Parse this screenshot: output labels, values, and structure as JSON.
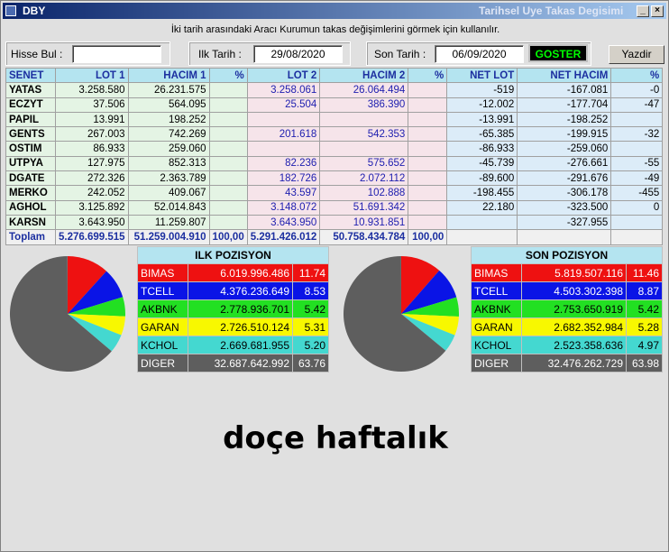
{
  "window": {
    "title": "DBY",
    "message": "Tarihsel Uye Takas Degisimi"
  },
  "info_text": "İki tarih arasındaki  Aracı Kurumun takas değişimlerini görmek için kullanılır.",
  "form": {
    "hisse_label": "Hisse Bul :",
    "hisse_value": "",
    "ilk_label": "Ilk Tarih :",
    "ilk_value": "29/08/2020",
    "son_label": "Son Tarih :",
    "son_value": "06/09/2020",
    "goster_label": "GOSTER",
    "yazdir_label": "Yazdir"
  },
  "table": {
    "headers": [
      "SENET",
      "LOT 1",
      "HACIM 1",
      "%",
      "LOT 2",
      "HACIM 2",
      "%",
      "NET LOT",
      "NET HACIM",
      "%"
    ],
    "rows": [
      [
        "YATAS",
        "3.258.580",
        "26.231.575",
        "",
        "3.258.061",
        "26.064.494",
        "",
        "-519",
        "-167.081",
        "-0"
      ],
      [
        "ECZYT",
        "37.506",
        "564.095",
        "",
        "25.504",
        "386.390",
        "",
        "-12.002",
        "-177.704",
        "-47"
      ],
      [
        "PAPIL",
        "13.991",
        "198.252",
        "",
        "",
        "",
        "",
        "-13.991",
        "-198.252",
        ""
      ],
      [
        "GENTS",
        "267.003",
        "742.269",
        "",
        "201.618",
        "542.353",
        "",
        "-65.385",
        "-199.915",
        "-32"
      ],
      [
        "OSTIM",
        "86.933",
        "259.060",
        "",
        "",
        "",
        "",
        "-86.933",
        "-259.060",
        ""
      ],
      [
        "UTPYA",
        "127.975",
        "852.313",
        "",
        "82.236",
        "575.652",
        "",
        "-45.739",
        "-276.661",
        "-55"
      ],
      [
        "DGATE",
        "272.326",
        "2.363.789",
        "",
        "182.726",
        "2.072.112",
        "",
        "-89.600",
        "-291.676",
        "-49"
      ],
      [
        "MERKO",
        "242.052",
        "409.067",
        "",
        "43.597",
        "102.888",
        "",
        "-198.455",
        "-306.178",
        "-455"
      ],
      [
        "AGHOL",
        "3.125.892",
        "52.014.843",
        "",
        "3.148.072",
        "51.691.342",
        "",
        "22.180",
        "-323.500",
        "0"
      ],
      [
        "KARSN",
        "3.643.950",
        "11.259.807",
        "",
        "3.643.950",
        "10.931.851",
        "",
        "",
        "-327.955",
        ""
      ]
    ],
    "total": [
      "Toplam",
      "5.276.699.515",
      "51.259.004.910",
      "100,00",
      "5.291.426.012",
      "50.758.434.784",
      "100,00",
      "",
      "",
      ""
    ]
  },
  "ilk_pozisyon": {
    "title": "ILK POZISYON",
    "rows": [
      {
        "name": "BIMAS",
        "value": "6.019.996.486",
        "pct": "11.74",
        "bg": "#ee1111",
        "fg": "#ffffff"
      },
      {
        "name": "TCELL",
        "value": "4.376.236.649",
        "pct": "8.53",
        "bg": "#0a14e6",
        "fg": "#ffffff"
      },
      {
        "name": "AKBNK",
        "value": "2.778.936.701",
        "pct": "5.42",
        "bg": "#22e022",
        "fg": "#000000"
      },
      {
        "name": "GARAN",
        "value": "2.726.510.124",
        "pct": "5.31",
        "bg": "#f8f800",
        "fg": "#000000"
      },
      {
        "name": "KCHOL",
        "value": "2.669.681.955",
        "pct": "5.20",
        "bg": "#44d8d0",
        "fg": "#000000"
      },
      {
        "name": "DIGER",
        "value": "32.687.642.992",
        "pct": "63.76",
        "bg": "#5e5e5e",
        "fg": "#ffffff"
      }
    ]
  },
  "son_pozisyon": {
    "title": "SON POZISYON",
    "rows": [
      {
        "name": "BIMAS",
        "value": "5.819.507.116",
        "pct": "11.46",
        "bg": "#ee1111",
        "fg": "#ffffff"
      },
      {
        "name": "TCELL",
        "value": "4.503.302.398",
        "pct": "8.87",
        "bg": "#0a14e6",
        "fg": "#ffffff"
      },
      {
        "name": "AKBNK",
        "value": "2.753.650.919",
        "pct": "5.42",
        "bg": "#22e022",
        "fg": "#000000"
      },
      {
        "name": "GARAN",
        "value": "2.682.352.984",
        "pct": "5.28",
        "bg": "#f8f800",
        "fg": "#000000"
      },
      {
        "name": "KCHOL",
        "value": "2.523.358.636",
        "pct": "4.97",
        "bg": "#44d8d0",
        "fg": "#000000"
      },
      {
        "name": "DIGER",
        "value": "32.476.262.729",
        "pct": "63.98",
        "bg": "#5e5e5e",
        "fg": "#ffffff"
      }
    ]
  },
  "caption": "doçe haftalık"
}
